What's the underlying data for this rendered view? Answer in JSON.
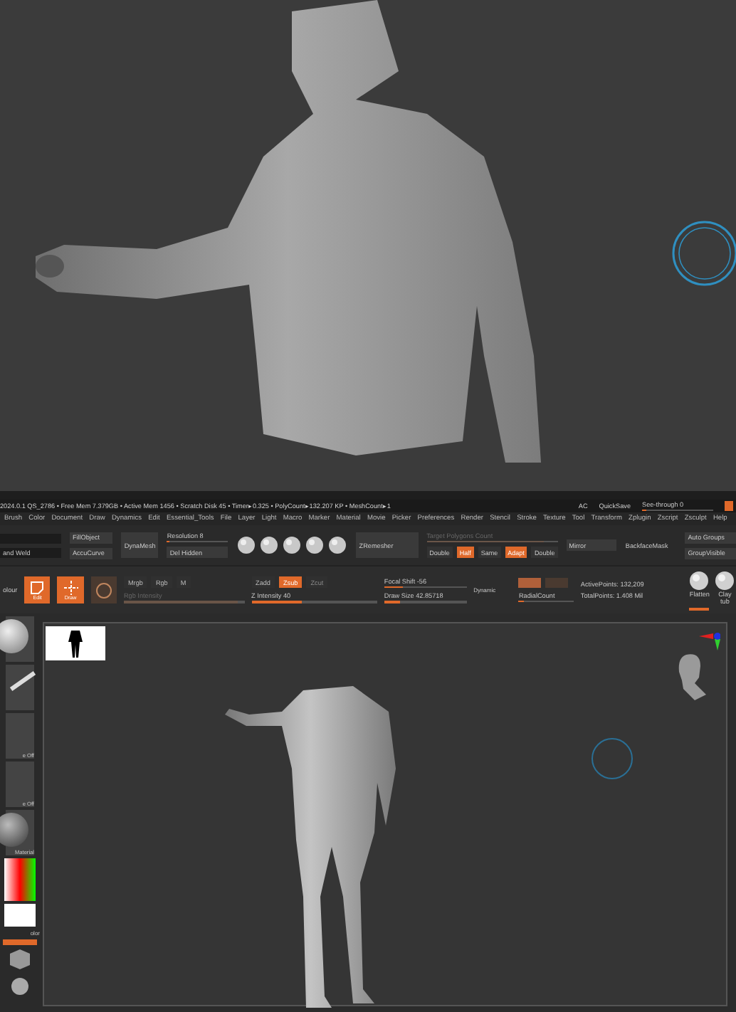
{
  "status": {
    "left": "2024.0.1  QS_2786  • Free Mem 7.379GB • Active Mem 1456 • Scratch Disk 45 • Timer▸0.325 • PolyCount▸132.207 KP • MeshCount▸1",
    "right": [
      "AC",
      "QuickSave"
    ],
    "seethrough": {
      "label": "See-through  0",
      "level": 0.05
    }
  },
  "menu": [
    "Brush",
    "Color",
    "Document",
    "Draw",
    "Dynamics",
    "Edit",
    "Essential_Tools",
    "File",
    "Layer",
    "Light",
    "Macro",
    "Marker",
    "Material",
    "Movie",
    "Picker",
    "Preferences",
    "Render",
    "Stencil",
    "Stroke",
    "Texture",
    "Tool",
    "Transform",
    "Zplugin",
    "Zscript",
    "Zsculpt",
    "Help"
  ],
  "palette": {
    "weld_field": "and Weld",
    "buttons": [
      "FillObject",
      "AccuCurve"
    ],
    "dynamesh": "DynaMesh",
    "resolution": {
      "label": "Resolution 8",
      "level": 0.05
    },
    "del_hidden": "Del Hidden",
    "zremesher": "ZRemesher",
    "target": {
      "label": "Target Polygons Count",
      "level": 0.9,
      "disabled": true
    },
    "modes": [
      {
        "label": "Double",
        "on": false
      },
      {
        "label": "Half",
        "on": true
      },
      {
        "label": "Same",
        "on": false
      },
      {
        "label": "Adapt",
        "on": true
      },
      {
        "label": "Double",
        "on": false
      }
    ],
    "mirror": "Mirror",
    "backface": "BackfaceMask",
    "groups": [
      "Auto Groups",
      "GroupVisible"
    ]
  },
  "shelf": {
    "left_label": "olour",
    "modes": [
      {
        "kind": "edit",
        "label": "Edit",
        "on": true
      },
      {
        "kind": "draw",
        "label": "Draw",
        "on": true
      },
      {
        "kind": "rotate",
        "on": false
      }
    ],
    "rgb": [
      {
        "label": "Mrgb"
      },
      {
        "label": "Rgb"
      },
      {
        "label": "M"
      }
    ],
    "rgb_intensity": {
      "label": "Rgb Intensity",
      "level": 0.95,
      "disabled": true
    },
    "z": [
      {
        "label": "Zadd",
        "on": false,
        "disabled": false
      },
      {
        "label": "Zsub",
        "on": true,
        "disabled": false
      },
      {
        "label": "Zcut",
        "on": false,
        "disabled": true
      }
    ],
    "z_intensity": {
      "label": "Z Intensity 40",
      "level": 0.4
    },
    "focal": {
      "label": "Focal Shift -56",
      "level": 0.22
    },
    "draw_size": {
      "label": "Draw Size 42.85718",
      "level": 0.2
    },
    "dynamic": "Dynamic",
    "symmetry": [
      {
        "on": true
      },
      {
        "on": false
      }
    ],
    "radial": {
      "label": "RadialCount",
      "level": 0.1
    },
    "points": [
      "ActivePoints: 132,209",
      "TotalPoints: 1.408 Mil"
    ],
    "brushes": [
      {
        "label": "Flatten",
        "selected": true
      },
      {
        "label": "Clay tub",
        "selected": false
      }
    ]
  },
  "tray": {
    "labels": [
      "e Off",
      "e Off",
      "Material"
    ],
    "color_label": "olor"
  }
}
